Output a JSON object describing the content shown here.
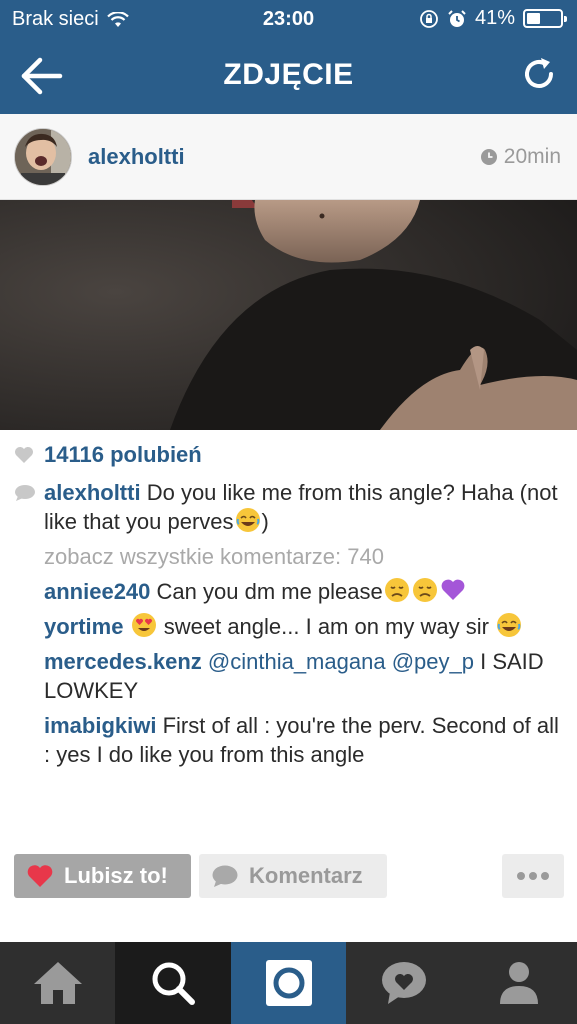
{
  "status_bar": {
    "carrier": "Brak sieci",
    "time": "23:00",
    "battery": "41%",
    "battery_level": 0.41
  },
  "nav": {
    "title": "ZDJĘCIE",
    "back_icon": "arrow-left-icon",
    "refresh_icon": "refresh-icon"
  },
  "post": {
    "username": "alexholtti",
    "time_ago": "20min",
    "likes": "14116 polubień",
    "caption_user": "alexholtti",
    "caption_text_1": "Do you like me from this angle? Haha (not like that you perves",
    "caption_text_2": ")",
    "see_all": "zobacz wszystkie komentarze: 740"
  },
  "comments": [
    {
      "user": "anniee240",
      "text": "Can you dm me please"
    },
    {
      "user": "yortime",
      "text_1": "sweet angle... I am on my way sir"
    },
    {
      "user": "mercedes.kenz",
      "mention_1": "@cinthia_magana",
      "mention_2": "@pey_p",
      "text": "I SAID LOWKEY"
    },
    {
      "user": "imabigkiwi",
      "text": "First of all : you're the perv. Second of all : yes I do like you from this angle"
    }
  ],
  "actions": {
    "like_label": "Lubisz to!",
    "comment_label": "Komentarz",
    "more_icon": "more-dots-icon"
  },
  "tabbar": {
    "items": [
      "home-icon",
      "search-icon",
      "camera-icon",
      "activity-icon",
      "profile-icon"
    ]
  },
  "colors": {
    "brand_blue": "#2a5d8a",
    "like_red": "#e8374a"
  }
}
